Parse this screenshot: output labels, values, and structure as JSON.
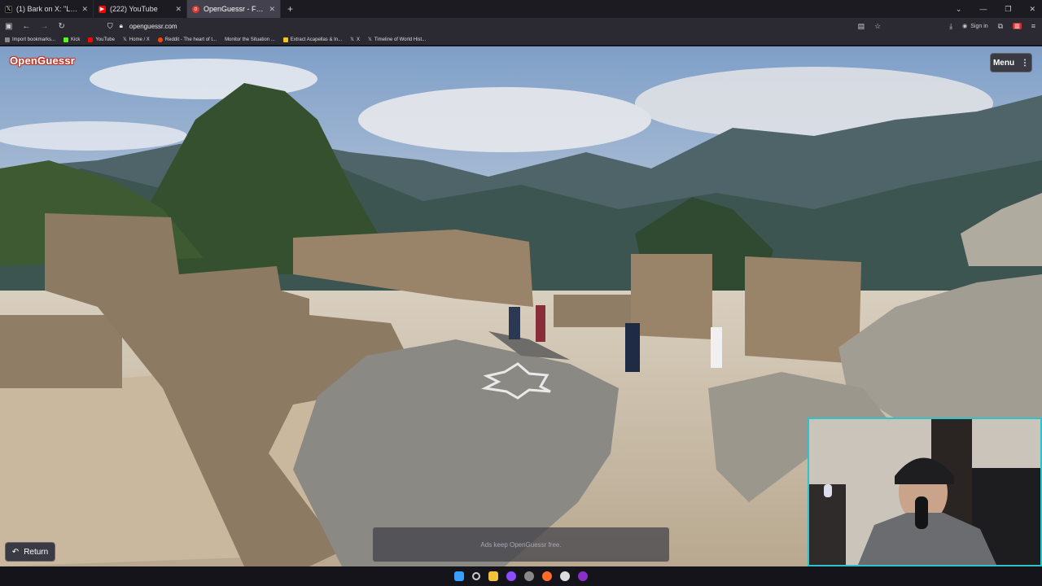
{
  "browser": {
    "tabs": [
      {
        "title": "(1) Bark on X: \"Let me explain w",
        "icon": "x-logo-icon",
        "color": "#000000"
      },
      {
        "title": "(222) YouTube",
        "icon": "youtube-icon",
        "color": "#ff0000"
      },
      {
        "title": "OpenGuessr - Free GeoGu",
        "icon": "openguessr-icon",
        "color": "#e03c31"
      }
    ],
    "new_tab": "+",
    "url": "openguessr.com",
    "sign_in": "Sign in",
    "bookmarks": [
      {
        "label": "Import bookmarks...",
        "color": "#888888"
      },
      {
        "label": "Kick",
        "color": "#53fc18"
      },
      {
        "label": "YouTube",
        "color": "#ff0000"
      },
      {
        "label": "Home / X",
        "color": "#ffffff"
      },
      {
        "label": "Reddit - The heart of t...",
        "color": "#ff4500"
      },
      {
        "label": "Monitor the Situation ...",
        "color": "#888888"
      },
      {
        "label": "Extract Acapellas & In...",
        "color": "#f5c518"
      },
      {
        "label": "X",
        "color": "#ffffff"
      },
      {
        "label": "Timeline of World Hist...",
        "color": "#ffffff"
      }
    ]
  },
  "game": {
    "logo": "OpenGuessr",
    "menu_label": "Menu",
    "return_label": "Return",
    "ads_text": "Ads keep OpenGuessr free."
  },
  "colors": {
    "accent": "#e03c31",
    "webcam_border": "#2fc2c9"
  }
}
